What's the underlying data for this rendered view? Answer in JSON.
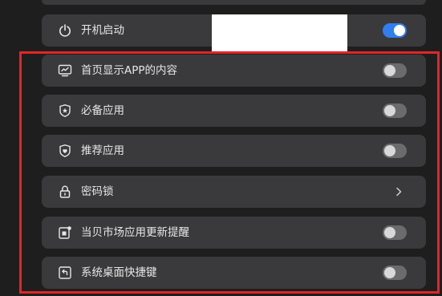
{
  "settings": {
    "items": [
      {
        "label": "开机启动",
        "icon": "power-icon",
        "control": "toggle",
        "enabled": true
      },
      {
        "label": "首页显示APP的内容",
        "icon": "screen-icon",
        "control": "toggle",
        "enabled": false
      },
      {
        "label": "必备应用",
        "icon": "shield-star-icon",
        "control": "toggle",
        "enabled": false
      },
      {
        "label": "推荐应用",
        "icon": "shield-heart-icon",
        "control": "toggle",
        "enabled": false
      },
      {
        "label": "密码锁",
        "icon": "lock-icon",
        "control": "chevron"
      },
      {
        "label": "当贝市场应用更新提醒",
        "icon": "notification-icon",
        "control": "toggle",
        "enabled": false
      },
      {
        "label": "系统桌面快捷键",
        "icon": "shortcut-icon",
        "control": "toggle",
        "enabled": false
      }
    ]
  },
  "colors": {
    "background": "#1e1e1e",
    "row": "#3a3a3c",
    "toggle_on": "#2f7ff0",
    "toggle_off": "#6b6b6e",
    "highlight": "#e1252a",
    "redaction": "#ffffff"
  }
}
